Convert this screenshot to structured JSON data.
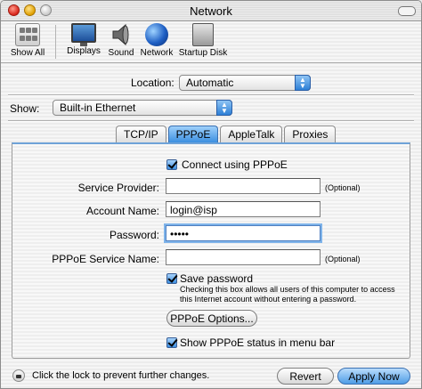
{
  "window": {
    "title": "Network"
  },
  "toolbar": {
    "items": [
      {
        "label": "Show All",
        "icon": "show-all-icon"
      },
      {
        "label": "Displays",
        "icon": "displays-icon"
      },
      {
        "label": "Sound",
        "icon": "sound-icon"
      },
      {
        "label": "Network",
        "icon": "network-icon"
      },
      {
        "label": "Startup Disk",
        "icon": "startup-disk-icon"
      }
    ]
  },
  "location": {
    "label": "Location:",
    "value": "Automatic"
  },
  "show": {
    "label": "Show:",
    "value": "Built-in Ethernet"
  },
  "tabs": [
    {
      "label": "TCP/IP",
      "active": false
    },
    {
      "label": "PPPoE",
      "active": true
    },
    {
      "label": "AppleTalk",
      "active": false
    },
    {
      "label": "Proxies",
      "active": false
    }
  ],
  "pppoe": {
    "connect_label": "Connect using PPPoE",
    "connect_checked": true,
    "service_provider": {
      "label": "Service Provider:",
      "value": "",
      "hint": "(Optional)"
    },
    "account_name": {
      "label": "Account Name:",
      "value": "login@isp"
    },
    "password": {
      "label": "Password:",
      "value": "•••••"
    },
    "service_name": {
      "label": "PPPoE Service Name:",
      "value": "",
      "hint": "(Optional)"
    },
    "save_password_label": "Save password",
    "save_password_checked": true,
    "save_password_note": "Checking this box allows all users of this computer to access this Internet account without entering a password.",
    "options_button": "PPPoE Options...",
    "show_status_label": "Show PPPoE status in menu bar",
    "show_status_checked": true
  },
  "footer": {
    "lock_text": "Click the lock to prevent further changes.",
    "revert_button": "Revert",
    "apply_button": "Apply Now"
  },
  "colors": {
    "accent": "#3c8fe0",
    "focus_ring": "#7fb4ea"
  }
}
